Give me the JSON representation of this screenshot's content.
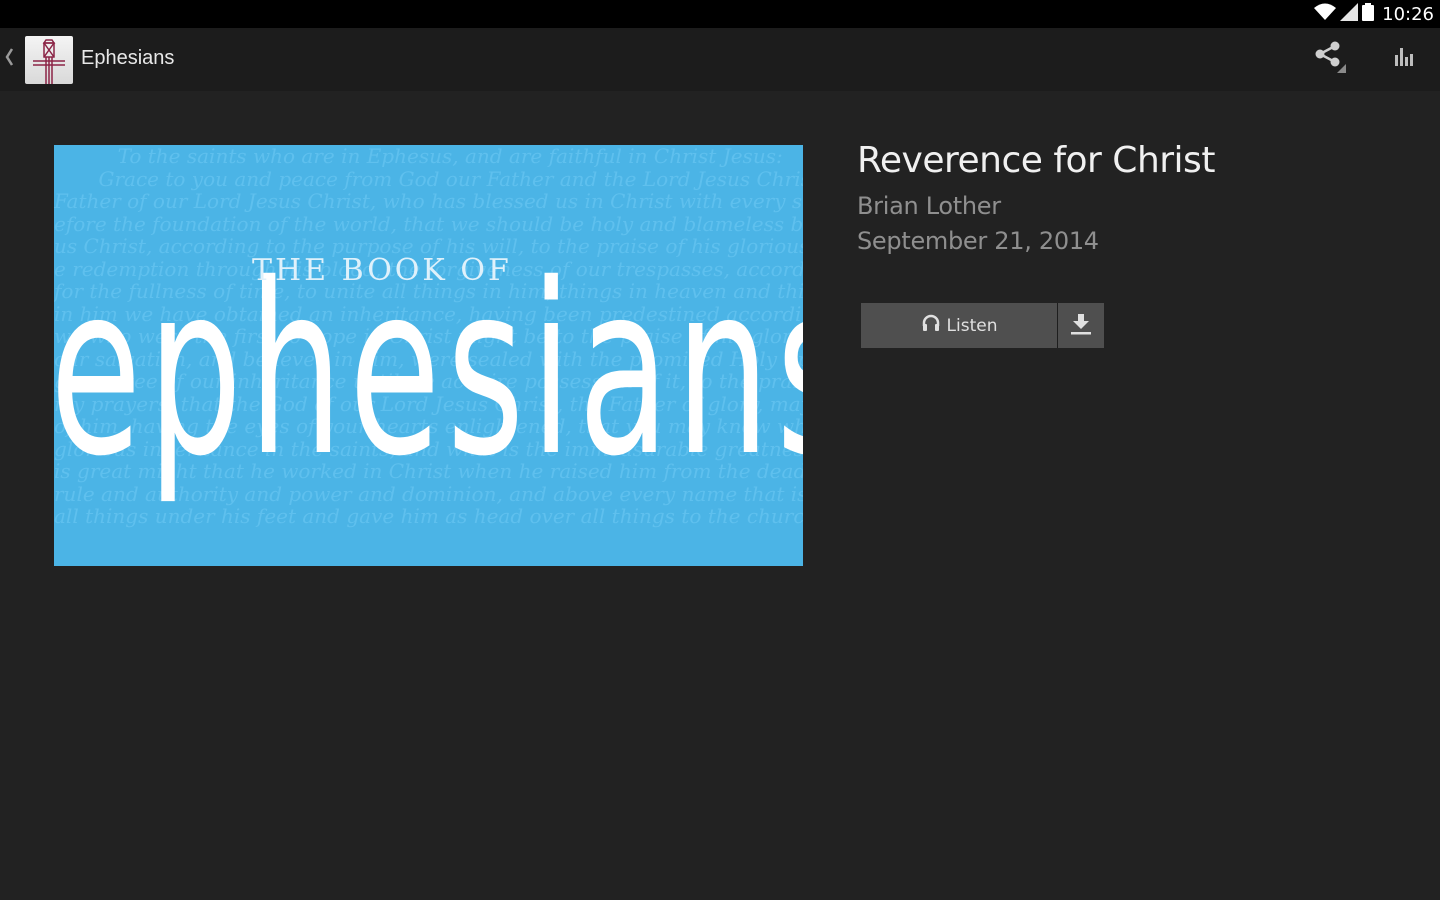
{
  "status_bar": {
    "time": "10:26",
    "icons": [
      "wifi-icon",
      "cell-signal-icon",
      "battery-icon"
    ]
  },
  "action_bar": {
    "back_icon": "chevron-left-icon",
    "app_logo": "church-tower-logo",
    "title": "Ephesians",
    "actions": [
      {
        "name": "share",
        "icon": "share-icon"
      },
      {
        "name": "stats",
        "icon": "bar-chart-icon"
      }
    ]
  },
  "artwork": {
    "subtitle": "THE BOOK OF",
    "title": "ephesians",
    "background_lines": [
      "          To the saints who are in Ephesus, and are faithful in Christ Jesus:",
      "       Grace to you and peace from God our Father and the Lord Jesus Christ.",
      "Father of our Lord Jesus Christ, who has blessed us in Christ with every spiritual blessing",
      "efore the foundation of the world, that we should be holy and blameless before him.",
      "us Christ, according to the purpose of his will, to the praise of his glorious grace, with",
      "e redemption through his blood, the forgiveness of our trespasses, according to the riches",
      "for the fullness of time, to unite all things in him, things in heaven and things on earth",
      "in him we have obtained an inheritance, having been predestined according to the purpose",
      "we who were the first to hope in Christ might be to the praise of his glory. In him you",
      "our salvation, and believed in him, were sealed with the promised Holy Spirit, who is",
      "guarantee of our inheritance until we acquire possession of it, to the praise of his glory.",
      "my prayers, that the God of our Lord Jesus Christ, the Father of glory, may give you",
      "of him, having the eyes of your hearts enlightened, that you may know what is the hope",
      "glorious inheritance in the saints, and what is the immeasurable greatness of his power",
      "is great might that he worked in Christ when he raised him from the dead and seated",
      "rule and authority and power and dominion, and above every name that is named, not",
      "all things under his feet and gave him as head over all things to the church, which is"
    ]
  },
  "sermon": {
    "title": "Reverence for Christ",
    "speaker": "Brian Lother",
    "date": "September 21, 2014"
  },
  "buttons": {
    "listen_label": "Listen",
    "listen_icon": "headphones-icon",
    "download_icon": "download-icon"
  },
  "colors": {
    "background": "#222222",
    "action_bar": "#1c1c1c",
    "artwork_blue": "#4bb4e6",
    "button_bg": "#4f4f4f",
    "logo_accent": "#8b2446"
  }
}
